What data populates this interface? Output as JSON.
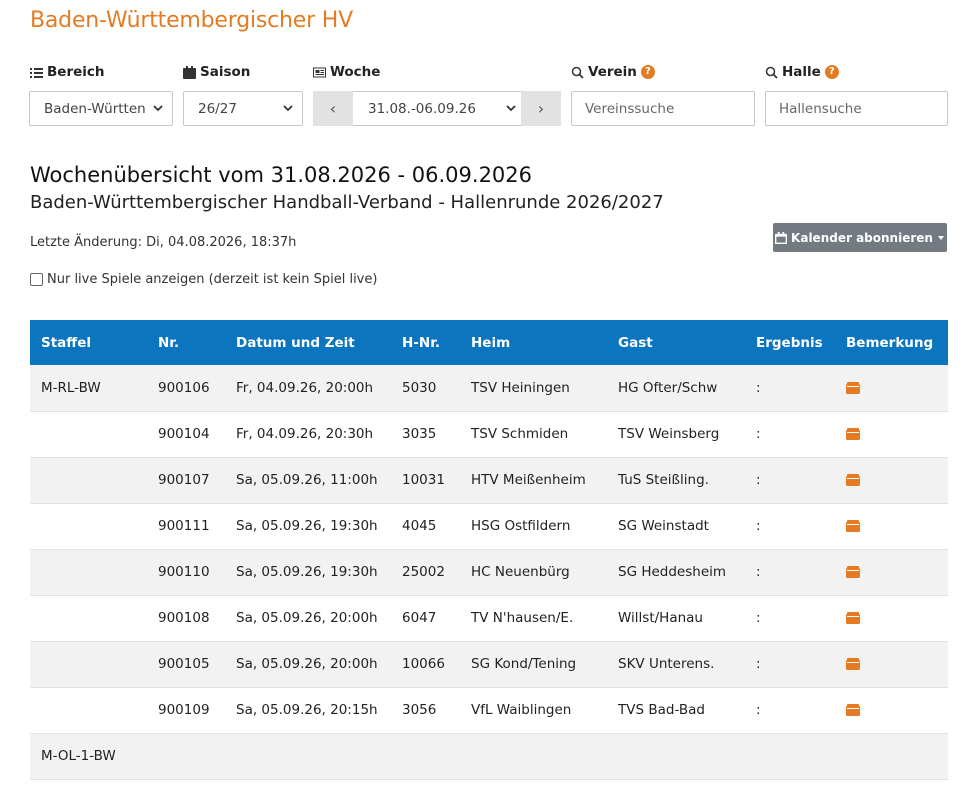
{
  "header": {
    "org_title": "Baden-Württembergischer HV"
  },
  "filters": {
    "bereich": {
      "label": "Bereich",
      "value": "Baden-Württen"
    },
    "saison": {
      "label": "Saison",
      "value": "26/27"
    },
    "woche": {
      "label": "Woche",
      "value": "31.08.-06.09.26",
      "prev": "‹",
      "next": "›"
    },
    "verein": {
      "label": "Verein",
      "help": "?",
      "placeholder": "Vereinssuche"
    },
    "halle": {
      "label": "Halle",
      "help": "?",
      "placeholder": "Hallensuche"
    }
  },
  "overview": {
    "title": "Wochenübersicht vom 31.08.2026 - 06.09.2026",
    "subtitle": "Baden-Württembergischer Handball-Verband - Hallenrunde 2026/2027",
    "last_change": "Letzte Änderung: Di, 04.08.2026, 18:37h",
    "calendar_button": "Kalender abonnieren",
    "live_only_label": "Nur live Spiele anzeigen (derzeit ist kein Spiel live)"
  },
  "table": {
    "headers": [
      "Staffel",
      "Nr.",
      "Datum und Zeit",
      "H-Nr.",
      "Heim",
      "Gast",
      "Ergebnis",
      "Bemerkung"
    ],
    "rows": [
      {
        "staffel": "M-RL-BW",
        "nr": "900106",
        "datum": "Fr, 04.09.26, 20:00h",
        "hnr": "5030",
        "heim": "TSV Heiningen",
        "gast": "HG Ofter/Schw",
        "ergebnis": ":"
      },
      {
        "staffel": "",
        "nr": "900104",
        "datum": "Fr, 04.09.26, 20:30h",
        "hnr": "3035",
        "heim": "TSV Schmiden",
        "gast": "TSV Weinsberg",
        "ergebnis": ":"
      },
      {
        "staffel": "",
        "nr": "900107",
        "datum": "Sa, 05.09.26, 11:00h",
        "hnr": "10031",
        "heim": "HTV Meißenheim",
        "gast": "TuS Steißling.",
        "ergebnis": ":"
      },
      {
        "staffel": "",
        "nr": "900111",
        "datum": "Sa, 05.09.26, 19:30h",
        "hnr": "4045",
        "heim": "HSG Ostfildern",
        "gast": "SG Weinstadt",
        "ergebnis": ":"
      },
      {
        "staffel": "",
        "nr": "900110",
        "datum": "Sa, 05.09.26, 19:30h",
        "hnr": "25002",
        "heim": "HC Neuenbürg",
        "gast": "SG Heddesheim",
        "ergebnis": ":"
      },
      {
        "staffel": "",
        "nr": "900108",
        "datum": "Sa, 05.09.26, 20:00h",
        "hnr": "6047",
        "heim": "TV N'hausen/E.",
        "gast": "Willst/Hanau",
        "ergebnis": ":"
      },
      {
        "staffel": "",
        "nr": "900105",
        "datum": "Sa, 05.09.26, 20:00h",
        "hnr": "10066",
        "heim": "SG Kond/Tening",
        "gast": "SKV Unterens.",
        "ergebnis": ":"
      },
      {
        "staffel": "",
        "nr": "900109",
        "datum": "Sa, 05.09.26, 20:15h",
        "hnr": "3056",
        "heim": "VfL Waiblingen",
        "gast": "TVS Bad-Bad",
        "ergebnis": ":"
      }
    ],
    "group_row": {
      "staffel": "M-OL-1-BW"
    }
  },
  "colors": {
    "accent": "#e47b22",
    "header_blue": "#0b75c0",
    "button_gray": "#737a81"
  }
}
